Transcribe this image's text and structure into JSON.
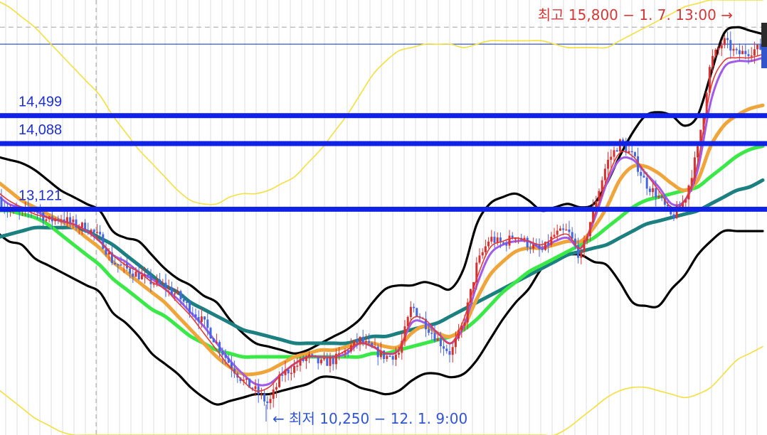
{
  "chart_data": {
    "type": "candlestick",
    "x_range": [
      "11.29",
      "1.7"
    ],
    "ylim": [
      9800,
      16200
    ],
    "grid": true,
    "colors": {
      "up": "#d93030",
      "down": "#4566e0",
      "level_line": "#1022e6",
      "high_guide": "#3355cc",
      "annot_high": "#d63737",
      "annot_low": "#2f55d4",
      "ma_short": "#e53935",
      "ma_mid": "#a05be8",
      "ma_orange": "#f0a53a",
      "ma_green": "#3ae848",
      "ma_teal": "#1d8080",
      "band_black": "#000000",
      "band_yellow": "#f4df3c",
      "grid": "#dcdcdc"
    },
    "levels": [
      {
        "value": 14499,
        "label": "14,499"
      },
      {
        "value": 14088,
        "label": "14,088"
      },
      {
        "value": 13121,
        "label": "13,121"
      }
    ],
    "high_guide_value": 15550,
    "annotations": {
      "high": {
        "text": "최고 15,800 − 1. 7. 13:00 →",
        "value": 15800
      },
      "low": {
        "text": "← 최저 10,250 − 12. 1. 9:00",
        "value": 10250
      }
    },
    "price_path": [
      13300,
      13100,
      13050,
      13150,
      12950,
      13000,
      12900,
      12850,
      12700,
      12350,
      12250,
      12150,
      12050,
      12000,
      11850,
      11650,
      11450,
      11150,
      10850,
      10600,
      10450,
      10250,
      10700,
      10800,
      10950,
      10850,
      10900,
      11050,
      11200,
      11050,
      10950,
      11000,
      11700,
      11450,
      11200,
      11000,
      11450,
      12300,
      12700,
      12600,
      12750,
      12600,
      12500,
      12750,
      12800,
      12400,
      13150,
      13800,
      14100,
      13900,
      13500,
      13300,
      13000,
      13250,
      14000,
      15300,
      15600,
      15400,
      15450,
      15500
    ],
    "series": [
      {
        "name": "",
        "kind": "ma_short",
        "values": [
          13400,
          13250,
          13150,
          13050,
          13000,
          12950,
          12900,
          12800,
          12650,
          12450,
          12300,
          12200,
          12050,
          11950,
          11750,
          11550,
          11300,
          11050,
          10800,
          10600,
          10450,
          10500,
          10700,
          10850,
          10950,
          10950,
          10950,
          11050,
          11150,
          11100,
          11000,
          11050,
          11500,
          11500,
          11300,
          11150,
          11500,
          12100,
          12550,
          12650,
          12700,
          12650,
          12600,
          12700,
          12750,
          12550,
          13000,
          13550,
          13950,
          13900,
          13650,
          13400,
          13150,
          13250,
          13800,
          14900,
          15300,
          15350,
          15350,
          15400
        ]
      },
      {
        "name": "",
        "kind": "ma_mid",
        "values": [
          13350,
          13200,
          13150,
          13100,
          13000,
          12950,
          12900,
          12800,
          12650,
          12450,
          12350,
          12200,
          12100,
          11950,
          11800,
          11600,
          11400,
          11150,
          10900,
          10700,
          10550,
          10550,
          10700,
          10850,
          10950,
          10950,
          10950,
          11000,
          11150,
          11100,
          11000,
          11050,
          11450,
          11450,
          11300,
          11150,
          11400,
          12000,
          12450,
          12600,
          12650,
          12650,
          12550,
          12650,
          12700,
          12550,
          12950,
          13500,
          13850,
          13850,
          13650,
          13450,
          13200,
          13250,
          13700,
          14700,
          15200,
          15300,
          15300,
          15350
        ]
      },
      {
        "name": "",
        "kind": "ma_orange",
        "values": [
          13550,
          13400,
          13250,
          13150,
          13050,
          12950,
          12850,
          12700,
          12550,
          12350,
          12200,
          12050,
          11900,
          11750,
          11550,
          11350,
          11150,
          10950,
          10800,
          10700,
          10700,
          10750,
          10850,
          10950,
          11000,
          11050,
          11050,
          11100,
          11150,
          11150,
          11100,
          11100,
          11300,
          11400,
          11300,
          11250,
          11400,
          11800,
          12150,
          12350,
          12500,
          12550,
          12550,
          12600,
          12650,
          12650,
          12850,
          13150,
          13550,
          13750,
          13750,
          13650,
          13500,
          13400,
          13550,
          14050,
          14350,
          14500,
          14600,
          14650
        ]
      },
      {
        "name": "",
        "kind": "ma_green",
        "values": [
          13100,
          13100,
          13050,
          13000,
          12900,
          12750,
          12600,
          12450,
          12300,
          12100,
          11950,
          11800,
          11650,
          11550,
          11400,
          11250,
          11150,
          11050,
          11000,
          10950,
          10950,
          10950,
          10950,
          10950,
          10950,
          10950,
          10950,
          10950,
          10950,
          11000,
          11000,
          11050,
          11100,
          11150,
          11200,
          11250,
          11350,
          11500,
          11700,
          11900,
          12050,
          12200,
          12300,
          12400,
          12500,
          12600,
          12700,
          12850,
          13000,
          13150,
          13250,
          13300,
          13350,
          13400,
          13450,
          13600,
          13750,
          13900,
          14000,
          14050
        ]
      },
      {
        "name": "",
        "kind": "ma_teal",
        "values": [
          12700,
          12750,
          12800,
          12850,
          12850,
          12850,
          12850,
          12800,
          12700,
          12600,
          12450,
          12300,
          12150,
          12000,
          11900,
          11750,
          11650,
          11550,
          11450,
          11350,
          11300,
          11250,
          11200,
          11150,
          11150,
          11150,
          11150,
          11150,
          11200,
          11250,
          11250,
          11300,
          11350,
          11400,
          11450,
          11550,
          11650,
          11750,
          11850,
          11950,
          12050,
          12150,
          12250,
          12350,
          12450,
          12500,
          12550,
          12600,
          12700,
          12800,
          12900,
          12950,
          13000,
          13050,
          13100,
          13200,
          13300,
          13400,
          13450,
          13550
        ]
      },
      {
        "name": "",
        "kind": "band_black",
        "values": [
          13900,
          13850,
          13800,
          13700,
          13550,
          13400,
          13300,
          13200,
          13100,
          12800,
          12700,
          12650,
          12450,
          12250,
          12100,
          12000,
          11850,
          11750,
          11500,
          11300,
          11150,
          11100,
          11050,
          11000,
          11050,
          11150,
          11250,
          11350,
          11500,
          11750,
          11950,
          12000,
          12000,
          12050,
          12000,
          11950,
          12250,
          12900,
          13200,
          13300,
          13350,
          13250,
          13100,
          13150,
          13200,
          13150,
          13200,
          13500,
          13900,
          14250,
          14500,
          14550,
          14500,
          14350,
          14500,
          15100,
          15700,
          15800,
          15750,
          15700
        ]
      },
      {
        "name": "",
        "kind": "band_black",
        "values": [
          12800,
          12650,
          12600,
          12400,
          12300,
          12200,
          12100,
          12000,
          11900,
          11600,
          11450,
          11250,
          11000,
          10850,
          10700,
          10500,
          10350,
          10250,
          10300,
          10350,
          10400,
          10400,
          10450,
          10500,
          10550,
          10650,
          10650,
          10600,
          10500,
          10450,
          10400,
          10450,
          10600,
          10700,
          10700,
          10650,
          10700,
          10900,
          11200,
          11500,
          11750,
          11950,
          12250,
          12400,
          12450,
          12450,
          12350,
          12300,
          12050,
          11750,
          11700,
          11700,
          11950,
          12150,
          12450,
          12650,
          12800,
          12800,
          12800,
          12800
        ]
      },
      {
        "name": "",
        "kind": "band_yellow",
        "values": [
          16200,
          16100,
          15950,
          15800,
          15600,
          15400,
          15200,
          15000,
          14800,
          14500,
          14250,
          14000,
          13800,
          13600,
          13400,
          13250,
          13200,
          13200,
          13300,
          13350,
          13350,
          13400,
          13500,
          13600,
          13800,
          14000,
          14250,
          14500,
          14800,
          15100,
          15300,
          15450,
          15500,
          15550,
          15550,
          15550,
          15500,
          15550,
          15600,
          15600,
          15600,
          15600,
          15600,
          15550,
          15500,
          15500,
          15500,
          15500,
          15600,
          15700,
          15800,
          15900,
          16000,
          16100,
          16150,
          16200,
          16200,
          16200,
          16200,
          16200
        ]
      },
      {
        "name": "",
        "kind": "band_yellow",
        "values": [
          10500,
          10350,
          10200,
          10050,
          9950,
          9850,
          9800,
          9800,
          9800,
          9800,
          9800,
          9800,
          9800,
          9800,
          9800,
          9800,
          9800,
          9800,
          9800,
          9800,
          9800,
          9800,
          9800,
          9800,
          9800,
          9800,
          9800,
          9800,
          9800,
          9800,
          9800,
          9800,
          9800,
          9800,
          9800,
          9800,
          9800,
          9800,
          9800,
          9800,
          9800,
          9800,
          9800,
          9800,
          9900,
          10050,
          10200,
          10350,
          10450,
          10500,
          10500,
          10450,
          10400,
          10350,
          10400,
          10500,
          10700,
          10900,
          11000,
          11100
        ]
      }
    ]
  }
}
